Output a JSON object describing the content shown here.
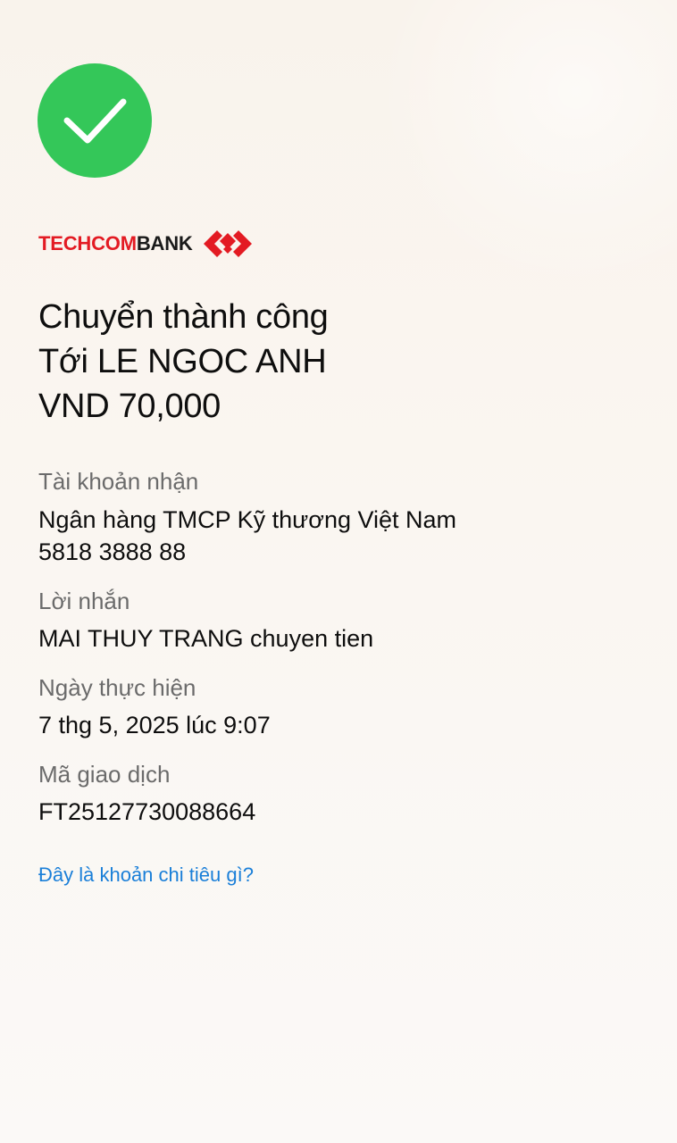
{
  "status": {
    "icon": "checkmark-circle-icon",
    "color": "#34c759"
  },
  "brand": {
    "name_part_red": "TECHCOM",
    "name_part_dark": "BANK",
    "logo_icon": "techcombank-diamond-logo",
    "red": "#e31b23"
  },
  "headline": {
    "line1": "Chuyển thành công",
    "line2": "Tới LE NGOC ANH",
    "line3": "VND 70,000"
  },
  "details": {
    "receiving_account": {
      "label": "Tài khoản nhận",
      "bank": "Ngân hàng TMCP Kỹ thương Việt Nam",
      "account_number": "5818 3888 88"
    },
    "message": {
      "label": "Lời nhắn",
      "value": "MAI THUY TRANG chuyen tien"
    },
    "date": {
      "label": "Ngày thực hiện",
      "value": "7 thg 5, 2025 lúc 9:07"
    },
    "transaction_id": {
      "label": "Mã giao dịch",
      "value": "FT25127730088664"
    }
  },
  "link": {
    "text": "Đây là khoản chi tiêu gì?",
    "color": "#1a7fd8"
  }
}
